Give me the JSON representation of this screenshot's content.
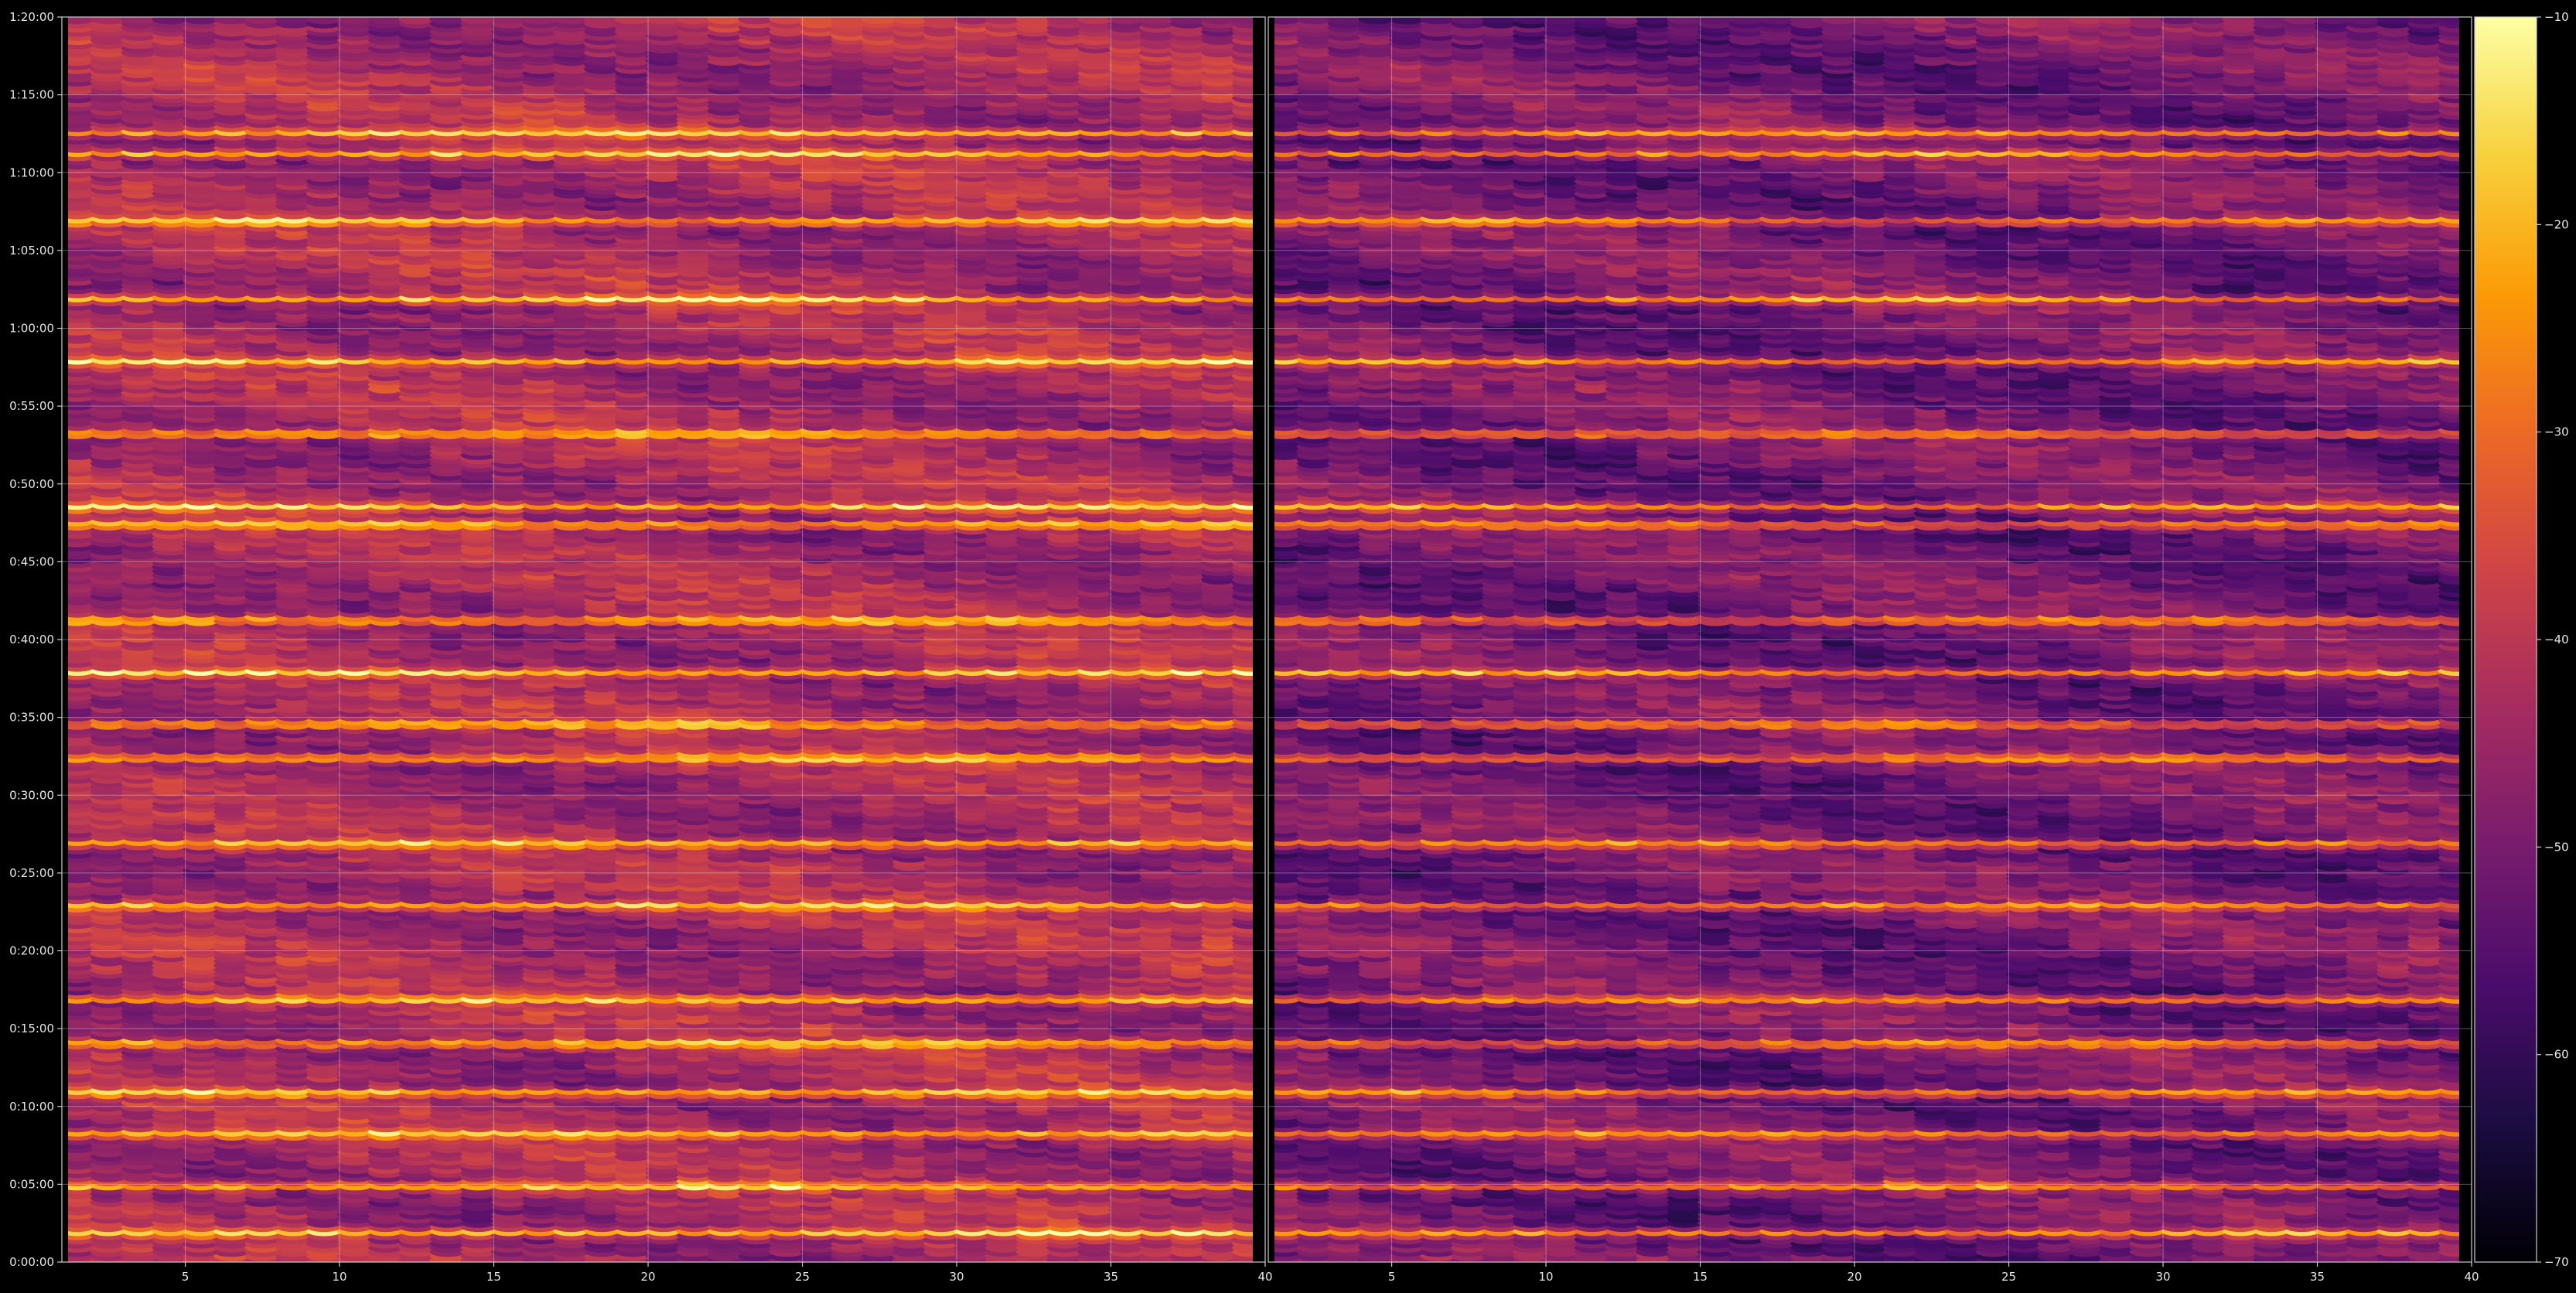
{
  "chart_data": [
    {
      "type": "heatmap",
      "panel": "left",
      "title": "",
      "xlabel": "",
      "ylabel": "",
      "x_range": [
        1,
        40
      ],
      "x_ticks": [
        5,
        10,
        15,
        20,
        25,
        30,
        35,
        40
      ],
      "x_tick_labels": [
        "5",
        "10",
        "15",
        "20",
        "25",
        "30",
        "35",
        "40"
      ],
      "y_range_seconds": [
        0,
        4800
      ],
      "y_ticks_seconds": [
        0,
        300,
        600,
        900,
        1200,
        1500,
        1800,
        2100,
        2400,
        2700,
        3000,
        3300,
        3600,
        3900,
        4200,
        4500,
        4800
      ],
      "y_tick_labels": [
        "0:00:00",
        "0:05:00",
        "0:10:00",
        "0:15:00",
        "0:20:00",
        "0:25:00",
        "0:30:00",
        "0:35:00",
        "0:40:00",
        "0:45:00",
        "0:50:00",
        "0:55:00",
        "1:00:00",
        "1:05:00",
        "1:10:00",
        "1:15:00",
        "1:20:00"
      ],
      "grid": true,
      "bright_band_times_seconds": [
        120,
        300,
        500,
        660,
        850,
        1020,
        1380,
        1620,
        1950,
        2080,
        2280,
        2480,
        2850,
        2920,
        3200,
        3480,
        3720,
        4020,
        4280,
        4360
      ],
      "colormap": "inferno"
    },
    {
      "type": "heatmap",
      "panel": "right",
      "title": "",
      "xlabel": "",
      "ylabel": "",
      "x_range": [
        1,
        40
      ],
      "x_ticks": [
        5,
        10,
        15,
        20,
        25,
        30,
        35,
        40
      ],
      "x_tick_labels": [
        "5",
        "10",
        "15",
        "20",
        "25",
        "30",
        "35",
        "40"
      ],
      "y_range_seconds": [
        0,
        4800
      ],
      "grid": true,
      "colormap": "inferno"
    }
  ],
  "colorbar": {
    "range": [
      -70,
      -10
    ],
    "ticks": [
      -10,
      -20,
      -30,
      -40,
      -50,
      -60,
      -70
    ],
    "tick_labels": [
      "−10",
      "−20",
      "−30",
      "−40",
      "−50",
      "−60",
      "−70"
    ]
  },
  "colors": {
    "background": "#000000",
    "axes": "#cccccc",
    "cmap_stops": [
      "#000004",
      "#1b0c41",
      "#4a0c6b",
      "#781c6d",
      "#a52c60",
      "#cf4446",
      "#ed6925",
      "#fb9b06",
      "#f7d13d",
      "#fcffa4"
    ]
  }
}
